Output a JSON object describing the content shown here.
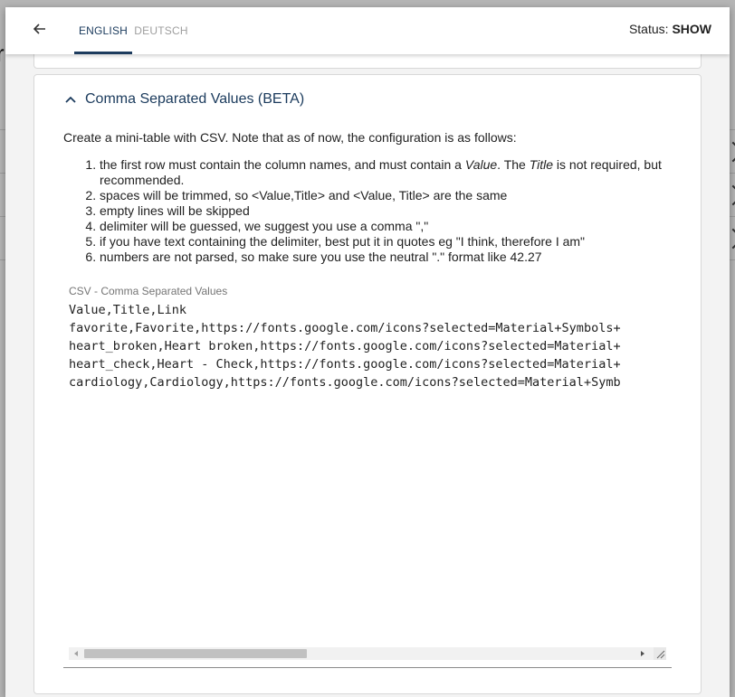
{
  "topbar": {
    "tabs": [
      {
        "label": "ENGLISH",
        "active": true
      },
      {
        "label": "DEUTSCH",
        "active": false
      }
    ],
    "status_label": "Status:",
    "status_value": "SHOW"
  },
  "section": {
    "title": "Comma Separated Values (BETA)",
    "intro": "Create a mini-table with CSV. Note that as of now, the configuration is as follows:",
    "rules": [
      {
        "prefix": "the first row must contain the column names, and must contain a ",
        "em1": "Value",
        "middle": ". The ",
        "em2": "Title",
        "suffix": " is not required, but recommended."
      },
      {
        "text": "spaces will be trimmed, so <Value,Title> and <Value, Title> are the same"
      },
      {
        "text": "empty lines will be skipped"
      },
      {
        "text": "delimiter will be guessed, we suggest you use a comma \",\""
      },
      {
        "text": "if you have text containing the delimiter, best put it in quotes eg \"I think, therefore I am\""
      },
      {
        "text": "numbers are not parsed, so make sure you use the neutral \".\" format like 42.27"
      }
    ],
    "field_label": "CSV - Comma Separated Values",
    "csv_value": "Value,Title,Link\nfavorite,Favorite,https://fonts.google.com/icons?selected=Material+Symbols+\nheart_broken,Heart broken,https://fonts.google.com/icons?selected=Material+\nheart_check,Heart - Check,https://fonts.google.com/icons?selected=Material+\ncardiology,Cardiology,https://fonts.google.com/icons?selected=Material+Symb"
  },
  "background": {
    "partial_letter": "r"
  },
  "icons": {
    "back": "arrow-left-icon",
    "collapse": "chevron-up-icon"
  },
  "colors": {
    "accent": "#1d3c5e",
    "inactive_tab": "#9e9e9e"
  }
}
